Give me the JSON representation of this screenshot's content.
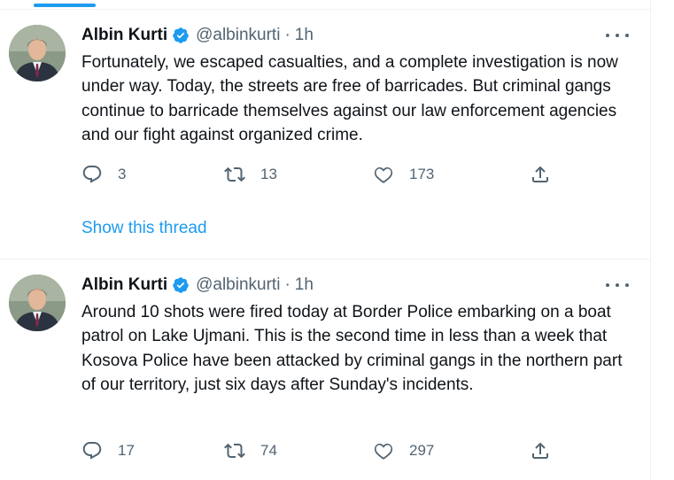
{
  "tweets": [
    {
      "author_name": "Albin Kurti",
      "handle": "@albinkurti",
      "separator": "·",
      "time": "1h",
      "text": "Fortunately, we escaped casualties, and a complete investigation is now under way. Today, the streets are free of barricades. But criminal gangs continue to barricade themselves against our law enforcement agencies and our fight against organized crime.",
      "replies": "3",
      "retweets": "13",
      "likes": "173",
      "show_thread": "Show this thread"
    },
    {
      "author_name": "Albin Kurti",
      "handle": "@albinkurti",
      "separator": "·",
      "time": "1h",
      "text": "Around 10 shots were fired today at Border Police embarking on a boat patrol on Lake Ujmani. This is the second time in less than a week that Kosova Police have been attacked by criminal gangs in the northern part of our territory, just six days after Sunday's incidents.",
      "replies": "17",
      "retweets": "74",
      "likes": "297"
    }
  ],
  "colors": {
    "accent": "#1d9bf0",
    "text": "#0f1419",
    "secondary": "#536471",
    "divider": "#eff3f4"
  },
  "icons": [
    "verified-badge-icon",
    "more-icon",
    "reply-icon",
    "retweet-icon",
    "like-icon",
    "share-icon"
  ]
}
